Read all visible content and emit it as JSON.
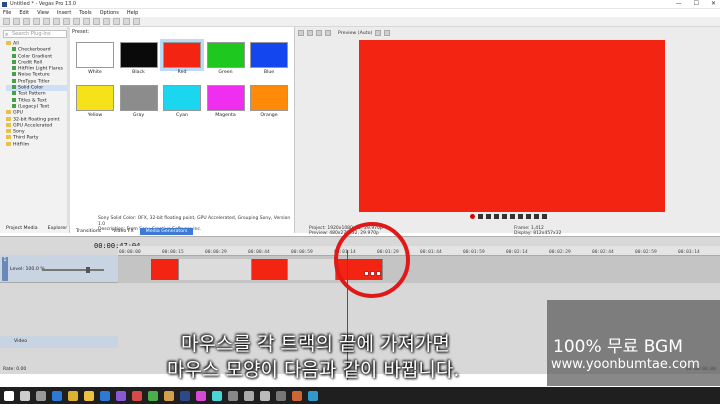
{
  "window": {
    "title": "Untitled * - Vegas Pro 13.0",
    "controls": [
      "—",
      "☐",
      "✕"
    ]
  },
  "menu": [
    "File",
    "Edit",
    "View",
    "Insert",
    "Tools",
    "Options",
    "Help"
  ],
  "explorer": {
    "search_placeholder": "Search Plug-Ins",
    "tree": [
      {
        "label": "All",
        "level": 0,
        "type": "folder"
      },
      {
        "label": "Checkerboard",
        "level": 1,
        "type": "fx"
      },
      {
        "label": "Color Gradient",
        "level": 1,
        "type": "fx"
      },
      {
        "label": "Credit Roll",
        "level": 1,
        "type": "fx"
      },
      {
        "label": "HitFilm Light Flares",
        "level": 1,
        "type": "fx"
      },
      {
        "label": "Noise Texture",
        "level": 1,
        "type": "fx"
      },
      {
        "label": "ProType Titler",
        "level": 1,
        "type": "fx"
      },
      {
        "label": "Solid Color",
        "level": 1,
        "type": "fx",
        "selected": true
      },
      {
        "label": "Test Pattern",
        "level": 1,
        "type": "fx"
      },
      {
        "label": "Titles & Text",
        "level": 1,
        "type": "fx"
      },
      {
        "label": "(Legacy) Text",
        "level": 1,
        "type": "fx"
      },
      {
        "label": "GPU",
        "level": 0,
        "type": "folder"
      },
      {
        "label": "32-bit floating point",
        "level": 0,
        "type": "folder"
      },
      {
        "label": "GPU Accelerated",
        "level": 0,
        "type": "folder"
      },
      {
        "label": "Sony",
        "level": 0,
        "type": "folder"
      },
      {
        "label": "Third Party",
        "level": 0,
        "type": "folder"
      },
      {
        "label": "HitFilm",
        "level": 0,
        "type": "folder"
      }
    ],
    "tabs": [
      "Project Media",
      "Explorer"
    ]
  },
  "preset": {
    "label": "Preset:",
    "swatches": [
      {
        "name": "White",
        "color": "#ffffff"
      },
      {
        "name": "Black",
        "color": "#0a0a0a"
      },
      {
        "name": "Red",
        "color": "#f42412",
        "selected": true
      },
      {
        "name": "Green",
        "color": "#1ec81e"
      },
      {
        "name": "Blue",
        "color": "#1446f0"
      },
      {
        "name": "Yellow",
        "color": "#f5e21a"
      },
      {
        "name": "Gray",
        "color": "#8c8c8c"
      },
      {
        "name": "Cyan",
        "color": "#1ad7ef"
      },
      {
        "name": "Magenta",
        "color": "#ef2ef0"
      },
      {
        "name": "Orange",
        "color": "#ff8a0a"
      }
    ],
    "description_1": "Sony Solid Color: OFX, 32-bit floating point, GPU Accelerated, Grouping Sony, Version 1.0",
    "description_2": "Description: From Sony Creative Software Inc.",
    "tabs": [
      {
        "label": "Transitions",
        "active": false
      },
      {
        "label": "Video FX",
        "active": false
      },
      {
        "label": "Media Generators",
        "active": true
      }
    ]
  },
  "preview": {
    "toolbar_label": "Preview (Auto)",
    "canvas_color": "#f42412",
    "info_left_1": "Project: 1920x1080x32, 29.970p",
    "info_left_2": "Preview: 480x270x32, 29.970p",
    "info_right_1": "Frame: 1,412",
    "info_right_2": "Display: 812x457x32"
  },
  "timeline": {
    "current_time": "00:00:47;04",
    "track_number": "1",
    "level_label": "Level: 100.0 %",
    "ticks": [
      "00:00:00",
      "00:00:15",
      "00:00:29",
      "00:00:44",
      "00:00:59",
      "00:01:14",
      "00:01:29",
      "00:01:44",
      "00:01:59",
      "00:02:14",
      "00:02:29",
      "00:02:44",
      "00:02:59",
      "00:03:14"
    ],
    "clips": [
      {
        "color": "red",
        "start": 0,
        "end": 0.1
      },
      {
        "color": "grey",
        "start": 0.1,
        "end": 0.36
      },
      {
        "color": "red",
        "start": 0.36,
        "end": 0.49
      },
      {
        "color": "grey",
        "start": 0.49,
        "end": 0.66
      },
      {
        "color": "red",
        "start": 0.66,
        "end": 0.83
      }
    ],
    "audio_track_label": "Video",
    "rate_label": "Rate: 0.00",
    "status_time": "00:00:00;00"
  },
  "subtitles": {
    "line1": "마우스를 각 트랙의 끝에 가져가면",
    "line2": "마우스 모양이 다음과 같이 바뀝니다."
  },
  "watermark": {
    "line1": "100% 무료 BGM",
    "line2": "www.yoonbumtae.com"
  },
  "taskbar_icons": [
    "start",
    "search",
    "task-view",
    "edge",
    "chrome",
    "explorer",
    "store",
    "app",
    "app",
    "app",
    "app",
    "vegas",
    "app",
    "app",
    "app",
    "app",
    "app",
    "app",
    "app",
    "app"
  ]
}
